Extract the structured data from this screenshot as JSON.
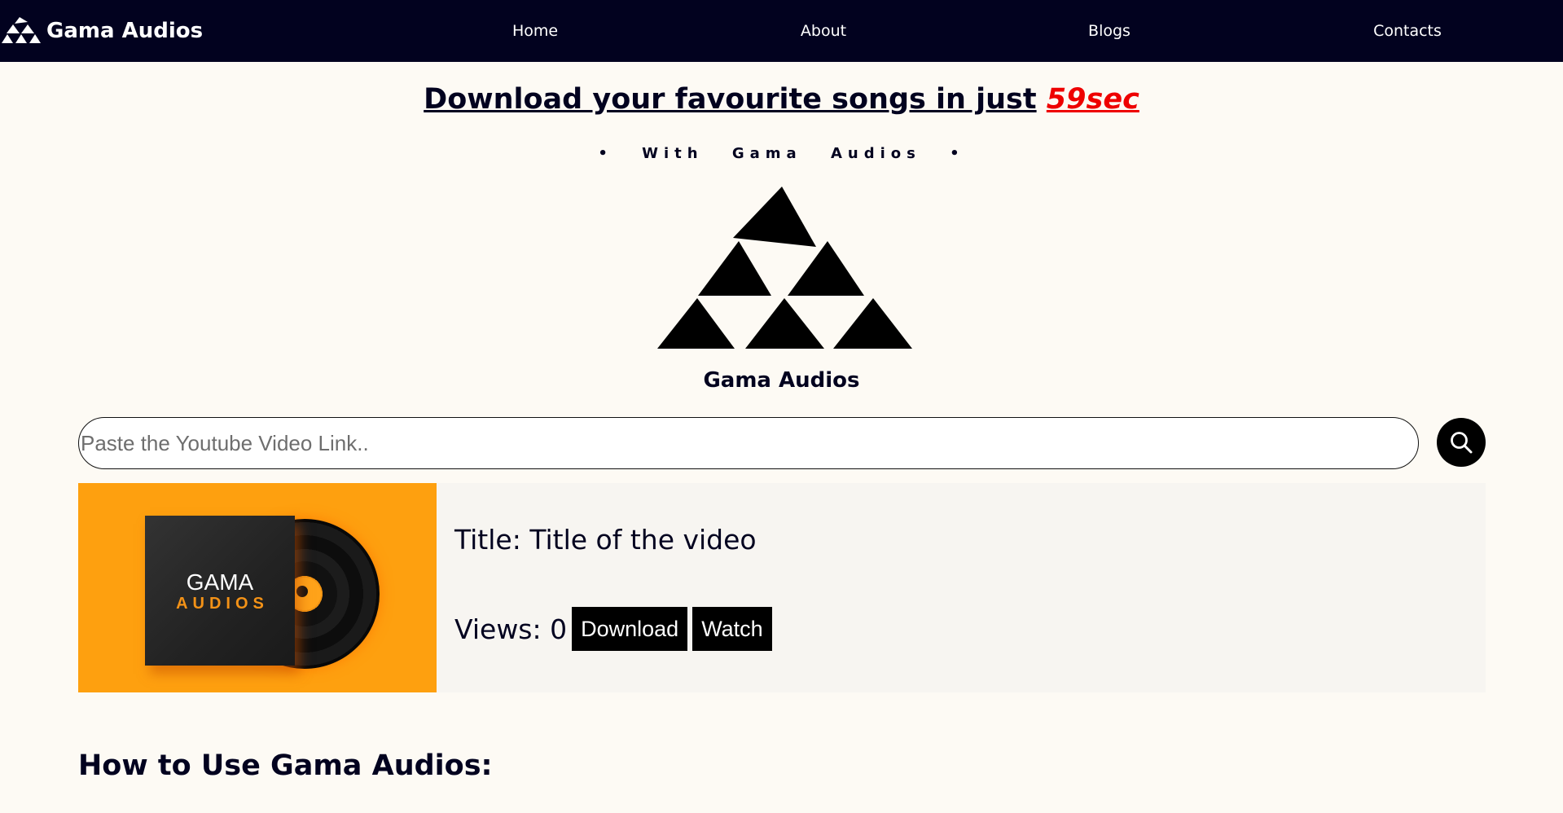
{
  "nav": {
    "brand": "Gama Audios",
    "brand_icon": "gama-triangles-logo-icon",
    "links": [
      "Home",
      "About",
      "Blogs",
      "Contacts"
    ]
  },
  "hero": {
    "headline_main": "Download your favourite songs in just",
    "headline_accent": "59sec",
    "tagline": "• With Gama Audios •",
    "logo_icon": "gama-triangles-logo-icon",
    "logo_caption": "Gama Audios"
  },
  "search": {
    "placeholder": "Paste the Youtube Video Link..",
    "value": "",
    "button_icon": "search-icon"
  },
  "result": {
    "thumbnail": {
      "title": "GAMA",
      "subtitle": "AUDIOS"
    },
    "title_text": "Title: Title of the video",
    "views_text": "Views: 0",
    "download_label": "Download",
    "watch_label": "Watch"
  },
  "section": {
    "howto_heading": "How to Use Gama Audios:"
  },
  "colors": {
    "nav_bg": "#02021f",
    "page_bg": "#fdfaf4",
    "accent_red": "#ee0000",
    "thumbnail_orange": "#fea00f",
    "button_bg": "#000000"
  }
}
